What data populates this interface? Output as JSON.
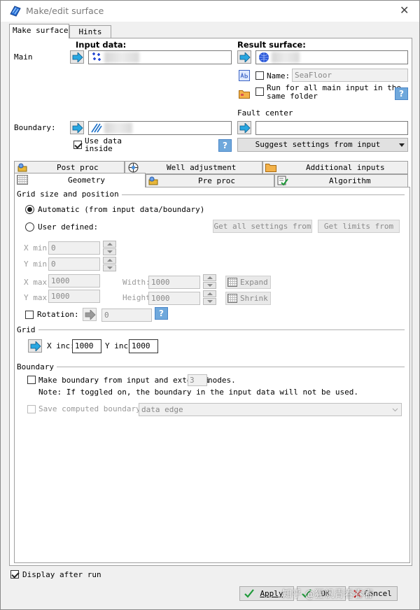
{
  "window": {
    "title": "Make/edit surface",
    "close_glyph": "✕"
  },
  "top_tabs": [
    {
      "label": "Make surface",
      "active": true
    },
    {
      "label": "Hints",
      "active": false
    }
  ],
  "main": {
    "row_label": "Main",
    "input_header": "Input data:",
    "result_header": "Result surface:",
    "name_label": "Name:",
    "name_value": "SeaFloor",
    "run_all_label_1": "Run for all main input in the",
    "run_all_label_2": "same folder",
    "boundary_label": "Boundary:",
    "use_data_inside_1": "Use data",
    "use_data_inside_2": "inside",
    "fault_center_label": "Fault center",
    "suggest_label": "Suggest settings from input",
    "help_glyph": "?"
  },
  "sub_tabs_row1": [
    {
      "label": "Post proc"
    },
    {
      "label": "Well adjustment"
    },
    {
      "label": "Additional inputs"
    }
  ],
  "sub_tabs_row2": [
    {
      "label": "Geometry",
      "active": true
    },
    {
      "label": "Pre proc"
    },
    {
      "label": "Algorithm"
    }
  ],
  "geometry": {
    "grid_size_section": "Grid size and position",
    "automatic_label": "Automatic (from input data/boundary)",
    "user_defined_label": "User defined:",
    "get_all_settings_label": "Get all settings from",
    "get_limits_label": "Get limits from",
    "xmin_label": "X min:",
    "xmin_value": "0",
    "ymin_label": "Y min:",
    "ymin_value": "0",
    "xmax_label": "X max:",
    "xmax_value": "1000",
    "ymax_label": "Y max:",
    "ymax_value": "1000",
    "width_label": "Width:",
    "width_value": "1000",
    "height_label": "Height",
    "height_value": "1000",
    "expand_label": "Expand",
    "shrink_label": "Shrink",
    "rotation_label": "Rotation:",
    "rotation_value": "0",
    "grid_section": "Grid",
    "xinc_label": "X inc:",
    "xinc_value": "1000",
    "yinc_label": "Y inc:",
    "yinc_value": "1000",
    "boundary_section": "Boundary",
    "make_boundary_label_a": "Make boundary from input and extend i",
    "make_boundary_nodes_value": "3",
    "make_boundary_label_b": "nodes.",
    "note_label": "Note: If toggled on, the boundary in the input data will not be used.",
    "save_boundary_label": "Save computed boundary fo",
    "save_boundary_select_value": "data edge"
  },
  "footer": {
    "display_after_run_label": "Display after run",
    "apply_label": "Apply",
    "ok_label": "OK",
    "cancel_label": "Cancel",
    "watermark": "知乎 @猩帆青春春春"
  },
  "colors": {
    "accent_blue": "#2a7fd4",
    "arrow_cyan": "#29a7e1",
    "disabled_text": "#8a8a8a"
  }
}
